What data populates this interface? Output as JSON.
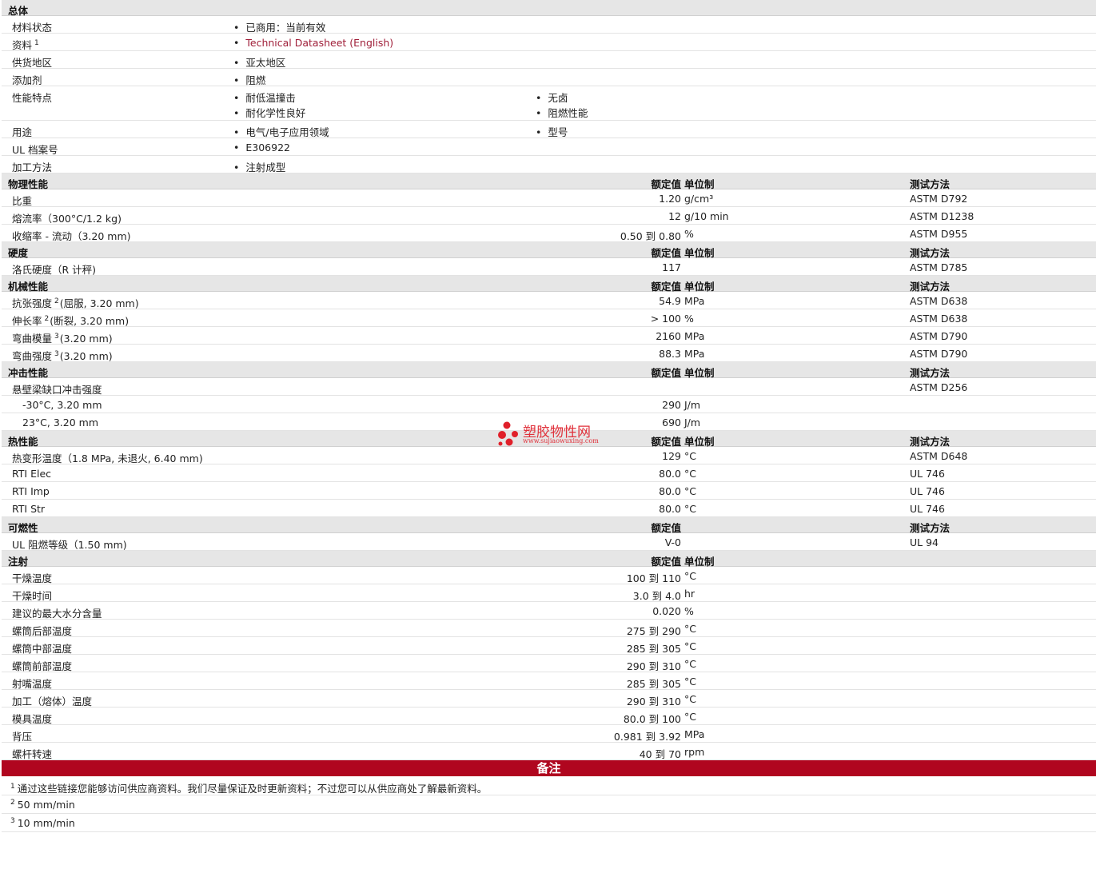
{
  "general": {
    "header": "总体",
    "status": {
      "label": "材料状态",
      "value": "已商用：当前有效"
    },
    "docs": {
      "label": "资料",
      "sup": "1",
      "value": "Technical Datasheet (English)"
    },
    "region": {
      "label": "供货地区",
      "value": "亚太地区"
    },
    "additive": {
      "label": "添加剂",
      "value": "阻燃"
    },
    "features": {
      "label": "性能特点",
      "v1": "耐低温撞击",
      "v2": "无卤",
      "v3": "耐化学性良好",
      "v4": "阻燃性能"
    },
    "uses": {
      "label": "用途",
      "v1": "电气/电子应用领域",
      "v2": "型号"
    },
    "ul": {
      "label": "UL 档案号",
      "value": "E306922"
    },
    "processing": {
      "label": "加工方法",
      "value": "注射成型"
    }
  },
  "headers": {
    "nominal": "额定值",
    "unit": "单位制",
    "test": "测试方法"
  },
  "physical": {
    "title": "物理性能",
    "rows": [
      {
        "label": "比重",
        "value": "1.20",
        "unit": "g/cm³",
        "test": "ASTM D792"
      },
      {
        "label": "熔流率（300°C/1.2 kg)",
        "value": "12",
        "unit": "g/10 min",
        "test": "ASTM D1238"
      },
      {
        "label": "收缩率 - 流动（3.20 mm)",
        "value": "0.50 到  0.80",
        "unit": "%",
        "test": "ASTM D955"
      }
    ]
  },
  "hardness": {
    "title": "硬度",
    "rows": [
      {
        "label": "洛氏硬度（R 计秤)",
        "value": "117",
        "unit": "",
        "test": "ASTM D785"
      }
    ]
  },
  "mechanical": {
    "title": "机械性能",
    "rows": [
      {
        "label": "抗张强度",
        "sup": "2",
        "suffix": "(屈服, 3.20 mm)",
        "value": "54.9",
        "unit": "MPa",
        "test": "ASTM D638"
      },
      {
        "label": "伸长率",
        "sup": "2",
        "suffix": "(断裂, 3.20 mm)",
        "value": "> 100",
        "unit": "%",
        "test": "ASTM D638"
      },
      {
        "label": "弯曲模量",
        "sup": "3",
        "suffix": "(3.20 mm)",
        "value": "2160",
        "unit": "MPa",
        "test": "ASTM D790"
      },
      {
        "label": "弯曲强度",
        "sup": "3",
        "suffix": "(3.20 mm)",
        "value": "88.3",
        "unit": "MPa",
        "test": "ASTM D790"
      }
    ]
  },
  "impact": {
    "title": "冲击性能",
    "main": {
      "label": "悬壁梁缺口冲击强度",
      "test": "ASTM D256"
    },
    "rows": [
      {
        "label": "-30°C, 3.20 mm",
        "value": "290",
        "unit": "J/m"
      },
      {
        "label": "23°C, 3.20 mm",
        "value": "690",
        "unit": "J/m"
      }
    ]
  },
  "thermal": {
    "title": "热性能",
    "rows": [
      {
        "label": "热变形温度（1.8 MPa, 未退火, 6.40 mm)",
        "value": "129",
        "unit": "°C",
        "test": "ASTM D648"
      },
      {
        "label": "RTI Elec",
        "value": "80.0",
        "unit": "°C",
        "test": "UL 746"
      },
      {
        "label": "RTI Imp",
        "value": "80.0",
        "unit": "°C",
        "test": "UL 746"
      },
      {
        "label": "RTI Str",
        "value": "80.0",
        "unit": "°C",
        "test": "UL 746"
      }
    ]
  },
  "flammability": {
    "title": "可燃性",
    "rows": [
      {
        "label": "UL 阻燃等级（1.50 mm)",
        "value": "V-0",
        "unit": "",
        "test": "UL 94"
      }
    ]
  },
  "injection": {
    "title": "注射",
    "rows": [
      {
        "label": "干燥温度",
        "value": "100 到  110",
        "unit": "°C"
      },
      {
        "label": "干燥时间",
        "value": "3.0 到  4.0",
        "unit": "hr"
      },
      {
        "label": "建议的最大水分含量",
        "value": "0.020",
        "unit": "%"
      },
      {
        "label": "螺筒后部温度",
        "value": "275 到  290",
        "unit": "°C"
      },
      {
        "label": "螺筒中部温度",
        "value": "285 到  305",
        "unit": "°C"
      },
      {
        "label": "螺筒前部温度",
        "value": "290 到  310",
        "unit": "°C"
      },
      {
        "label": "射嘴温度",
        "value": "285 到  305",
        "unit": "°C"
      },
      {
        "label": "加工（熔体）温度",
        "value": "290 到  310",
        "unit": "°C"
      },
      {
        "label": "模具温度",
        "value": "80.0 到  100",
        "unit": "°C"
      },
      {
        "label": "背压",
        "value": "0.981 到  3.92",
        "unit": "MPa"
      },
      {
        "label": "螺杆转速",
        "value": "40 到  70",
        "unit": "rpm"
      }
    ]
  },
  "notes": {
    "title": "备注",
    "items": [
      {
        "sup": "1",
        "text": "通过这些链接您能够访问供应商资料。我们尽量保证及时更新资料；不过您可以从供应商处了解最新资料。"
      },
      {
        "sup": "2",
        "text": "50 mm/min"
      },
      {
        "sup": "3",
        "text": "10 mm/min"
      }
    ]
  },
  "watermark": {
    "name": "塑胶物性网",
    "url": "www.sujiaowuxing.com"
  }
}
